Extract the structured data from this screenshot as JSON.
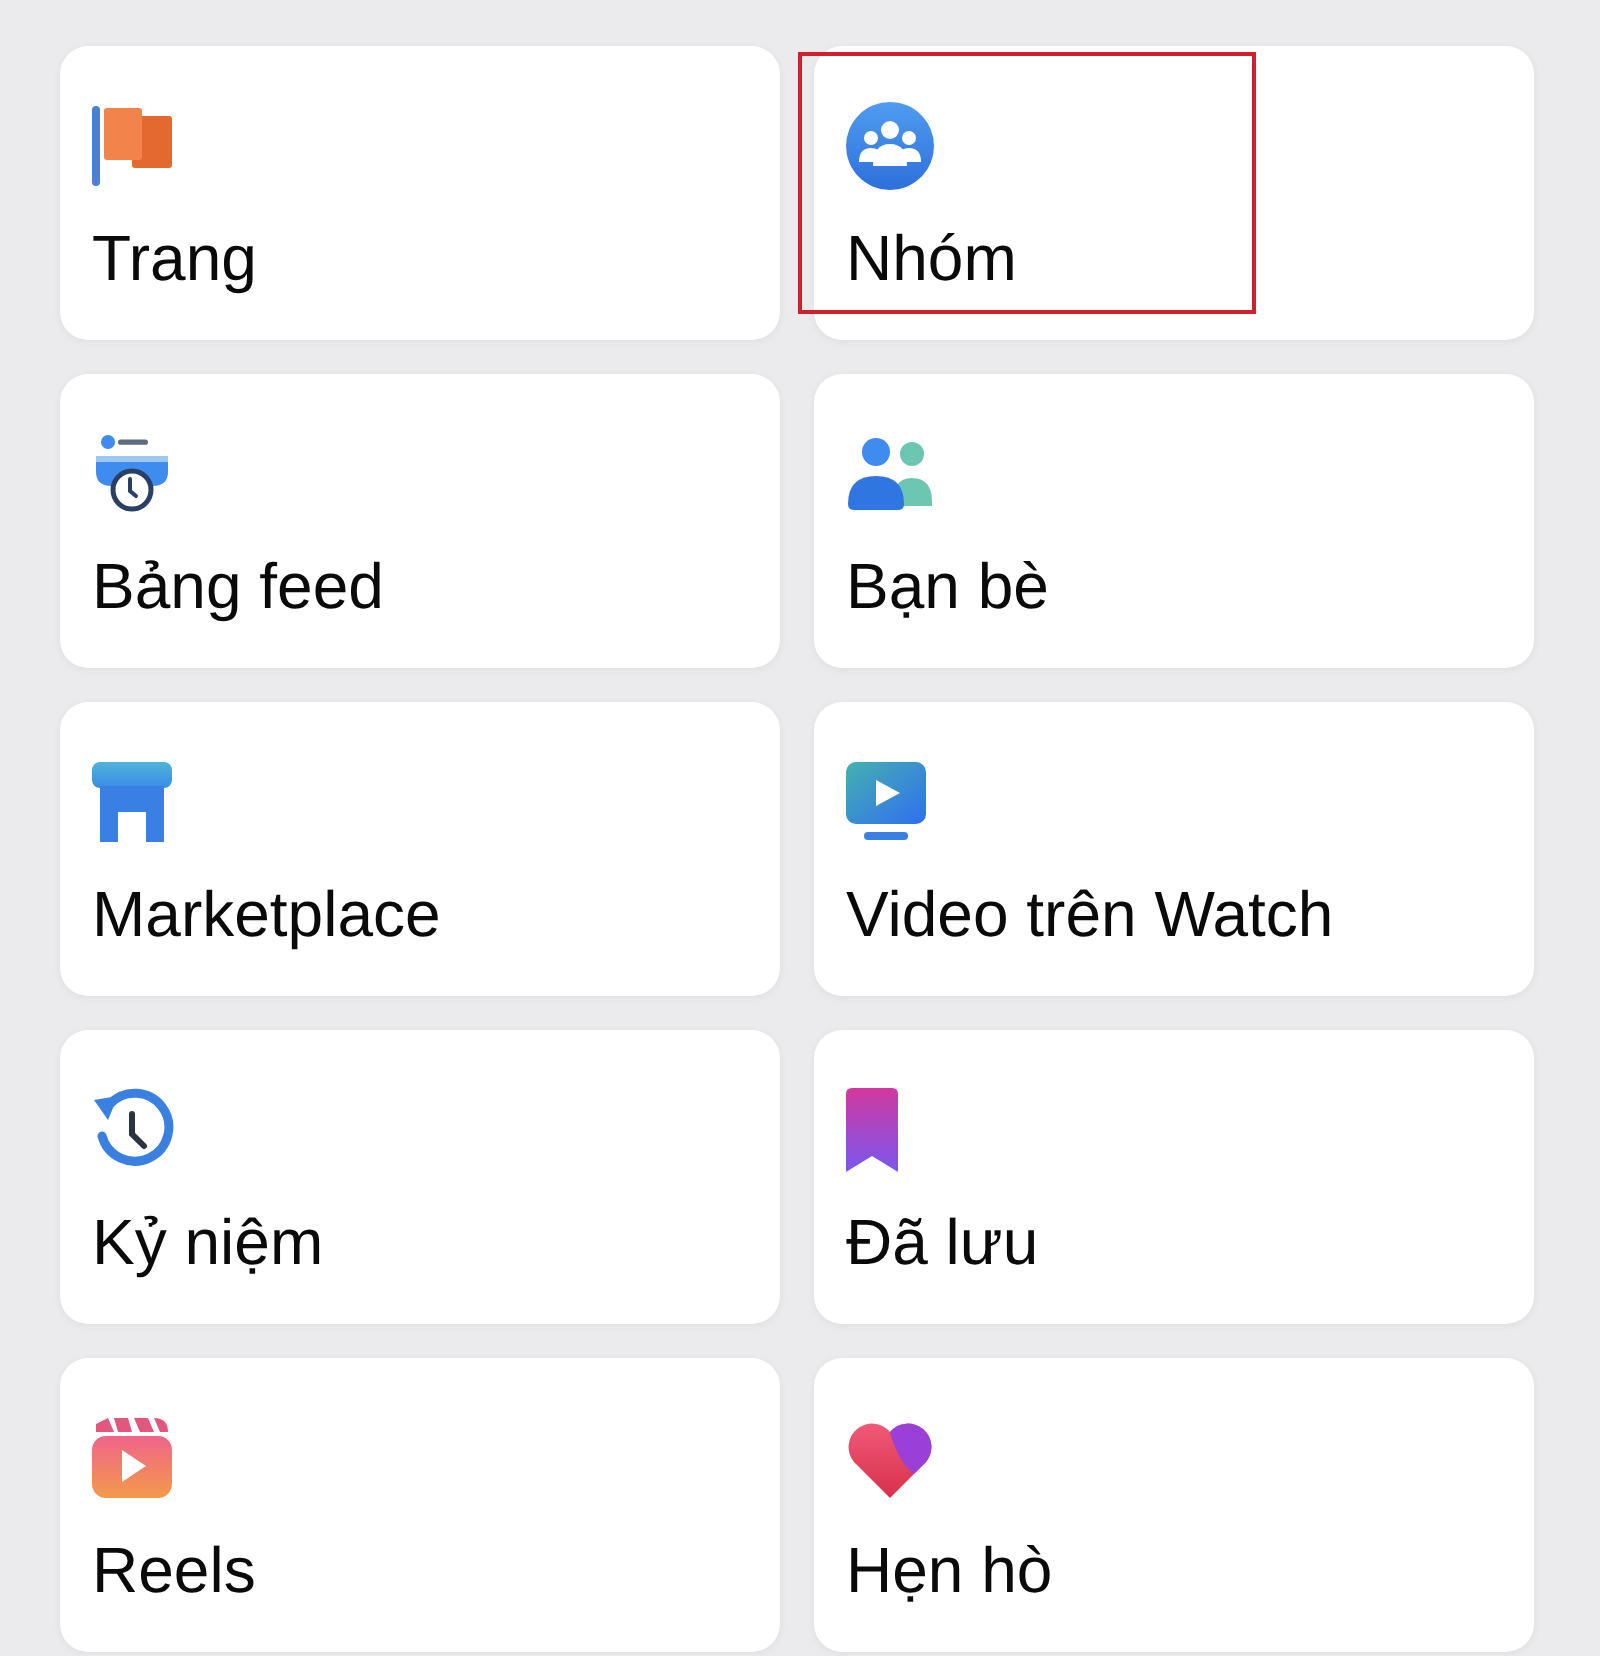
{
  "shortcuts": [
    {
      "kind": "pages",
      "label": "Trang",
      "highlighted": false
    },
    {
      "kind": "groups",
      "label": "Nhóm",
      "highlighted": true
    },
    {
      "kind": "feeds",
      "label": "Bảng feed",
      "highlighted": false
    },
    {
      "kind": "friends",
      "label": "Bạn bè",
      "highlighted": false
    },
    {
      "kind": "marketplace",
      "label": "Marketplace",
      "highlighted": false
    },
    {
      "kind": "video",
      "label": "Video trên Watch",
      "highlighted": false
    },
    {
      "kind": "memories",
      "label": "Kỷ niệm",
      "highlighted": false
    },
    {
      "kind": "saved",
      "label": "Đã lưu",
      "highlighted": false
    },
    {
      "kind": "reels",
      "label": "Reels",
      "highlighted": false
    },
    {
      "kind": "dating",
      "label": "Hẹn hò",
      "highlighted": false
    }
  ]
}
